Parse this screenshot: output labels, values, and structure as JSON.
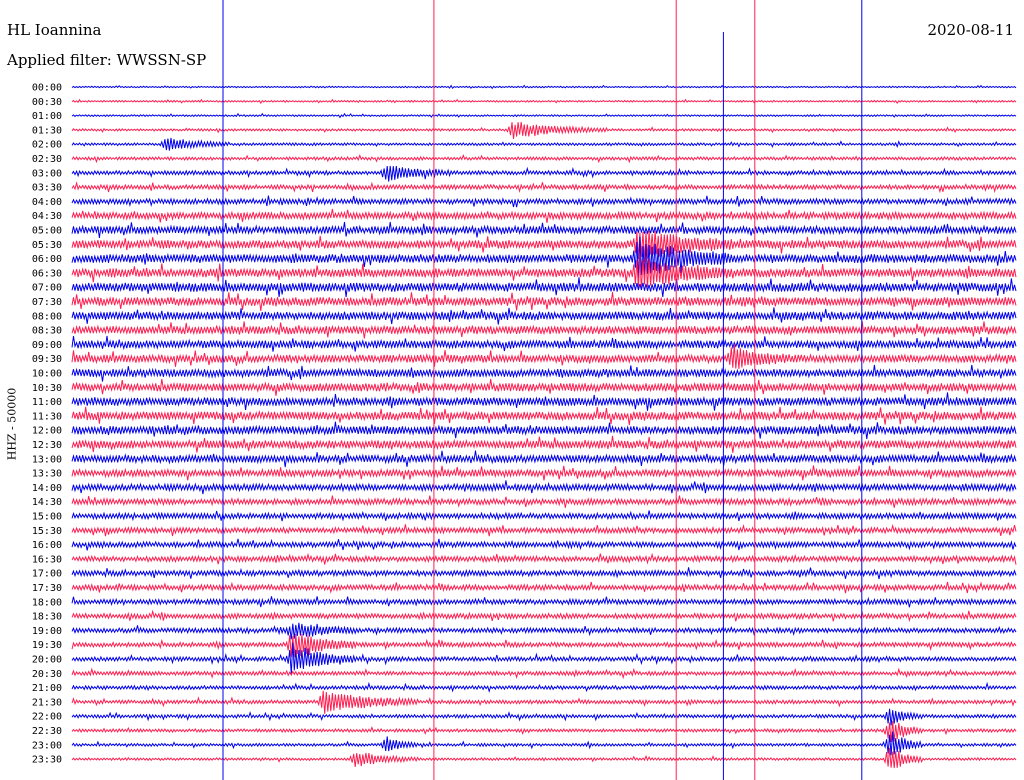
{
  "header": {
    "station": "HL Ioannina",
    "filter": "Applied filter: WWSSN-SP",
    "date": "2020-08-11",
    "channel": "HHZ - 50000"
  },
  "colors": {
    "trace_a": "#0000ee",
    "trace_b": "#ff1e50",
    "background": "#ffffff"
  },
  "chart_data": {
    "type": "line",
    "title": "",
    "xlabel": "",
    "ylabel": "HHZ - 50000",
    "row_labels": [
      "00:00",
      "00:30",
      "01:00",
      "01:30",
      "02:00",
      "02:30",
      "03:00",
      "03:30",
      "04:00",
      "04:30",
      "05:00",
      "05:30",
      "06:00",
      "06:30",
      "07:00",
      "07:30",
      "08:00",
      "08:30",
      "09:00",
      "09:30",
      "10:00",
      "10:30",
      "11:00",
      "11:30",
      "12:00",
      "12:30",
      "13:00",
      "13:30",
      "14:00",
      "14:30",
      "15:00",
      "15:30",
      "16:00",
      "16:30",
      "17:00",
      "17:30",
      "18:00",
      "18:30",
      "19:00",
      "19:30",
      "20:00",
      "20:30",
      "21:00",
      "21:30",
      "22:00",
      "22:30",
      "23:00",
      "23:30"
    ],
    "row_minutes": 30,
    "noise_level": [
      0.5,
      0.6,
      0.6,
      0.8,
      0.9,
      1.1,
      1.4,
      1.6,
      1.9,
      2.4,
      2.7,
      3.0,
      3.1,
      3.2,
      3.2,
      3.1,
      3.0,
      2.9,
      2.8,
      2.8,
      2.8,
      2.9,
      3.0,
      3.0,
      3.0,
      2.9,
      2.7,
      2.5,
      2.3,
      2.1,
      2.0,
      1.9,
      1.9,
      1.9,
      1.9,
      1.9,
      1.8,
      1.8,
      1.7,
      1.6,
      1.5,
      1.4,
      1.3,
      1.3,
      1.2,
      1.1,
      1.0,
      0.9
    ],
    "events": [
      {
        "row": 3,
        "minute": 14,
        "amplitude": 9,
        "duration_min": 3
      },
      {
        "row": 4,
        "minute": 3,
        "amplitude": 7,
        "duration_min": 2
      },
      {
        "row": 6,
        "minute": 10,
        "amplitude": 8,
        "duration_min": 2
      },
      {
        "row": 11,
        "minute": 18,
        "amplitude": 16,
        "duration_min": 3
      },
      {
        "row": 12,
        "minute": 18,
        "amplitude": 20,
        "duration_min": 3
      },
      {
        "row": 13,
        "minute": 18,
        "amplitude": 16,
        "duration_min": 3
      },
      {
        "row": 19,
        "minute": 21,
        "amplitude": 9,
        "duration_min": 2
      },
      {
        "row": 38,
        "minute": 7,
        "amplitude": 8,
        "duration_min": 2
      },
      {
        "row": 39,
        "minute": 7,
        "amplitude": 14,
        "duration_min": 2
      },
      {
        "row": 40,
        "minute": 7,
        "amplitude": 16,
        "duration_min": 2
      },
      {
        "row": 43,
        "minute": 8,
        "amplitude": 12,
        "duration_min": 3
      },
      {
        "row": 46,
        "minute": 10,
        "amplitude": 8,
        "duration_min": 1
      },
      {
        "row": 47,
        "minute": 9,
        "amplitude": 8,
        "duration_min": 2
      },
      {
        "row": 44,
        "minute": 26,
        "amplitude": 9,
        "duration_min": 1
      },
      {
        "row": 45,
        "minute": 26,
        "amplitude": 13,
        "duration_min": 1
      },
      {
        "row": 46,
        "minute": 26,
        "amplitude": 16,
        "duration_min": 1
      },
      {
        "row": 47,
        "minute": 26,
        "amplitude": 14,
        "duration_min": 1
      }
    ],
    "spikes": [
      {
        "minute": 4.8,
        "color": "trace_a"
      },
      {
        "minute": 11.5,
        "color": "trace_b"
      },
      {
        "minute": 19.2,
        "color": "trace_b"
      },
      {
        "minute": 20.7,
        "color": "trace_a"
      },
      {
        "minute": 21.7,
        "color": "trace_b"
      },
      {
        "minute": 25.1,
        "color": "trace_a"
      }
    ]
  }
}
